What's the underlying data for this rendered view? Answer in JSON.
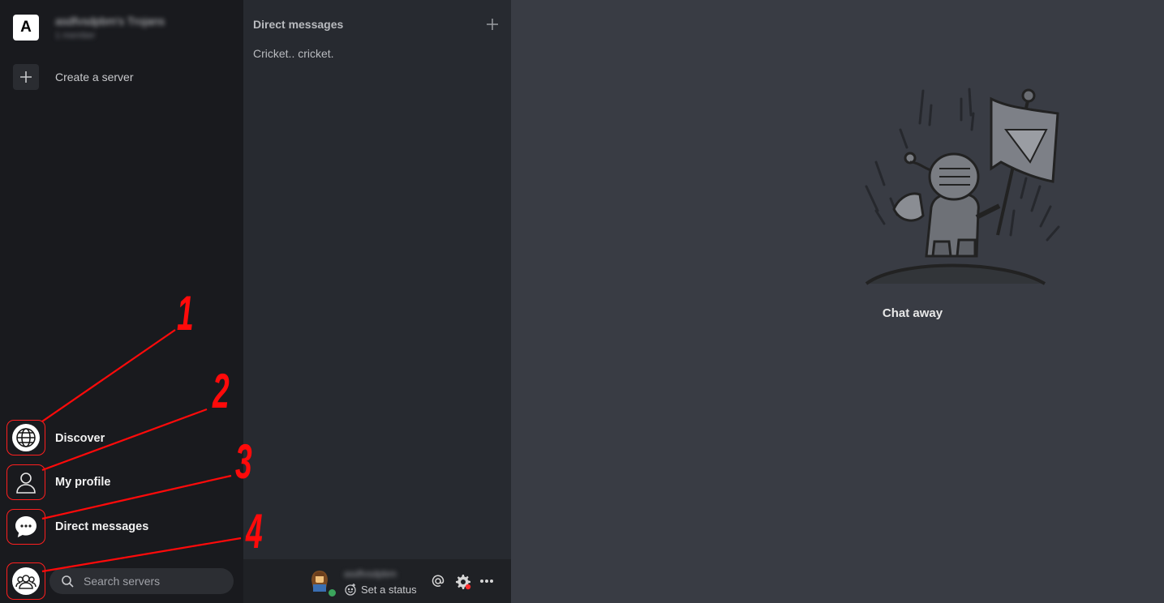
{
  "server": {
    "avatar_letter": "A",
    "name": "asdfvsdpbm's Trojans",
    "subtitle": "1 member"
  },
  "sidebar": {
    "create_label": "Create a server",
    "nav": [
      {
        "label": "Discover",
        "icon": "globe-icon"
      },
      {
        "label": "My profile",
        "icon": "user-icon"
      },
      {
        "label": "Direct messages",
        "icon": "chat-bubble-icon"
      }
    ],
    "search_placeholder": "Search servers"
  },
  "direct_messages": {
    "header": "Direct messages",
    "items": [
      "Cricket.. cricket."
    ]
  },
  "user_bar": {
    "username": "asdfvsdpbm",
    "set_status": "Set a status",
    "online_color": "#3ba55c",
    "settings_badge_color": "#ff2d2d"
  },
  "main": {
    "empty_state_text": "Chat away"
  },
  "annotations": [
    "1",
    "2",
    "3",
    "4"
  ],
  "colors": {
    "annotation": "#ff0a0a",
    "left_bg": "#191a1e",
    "middle_bg": "#272a30",
    "main_bg": "#393c44"
  }
}
